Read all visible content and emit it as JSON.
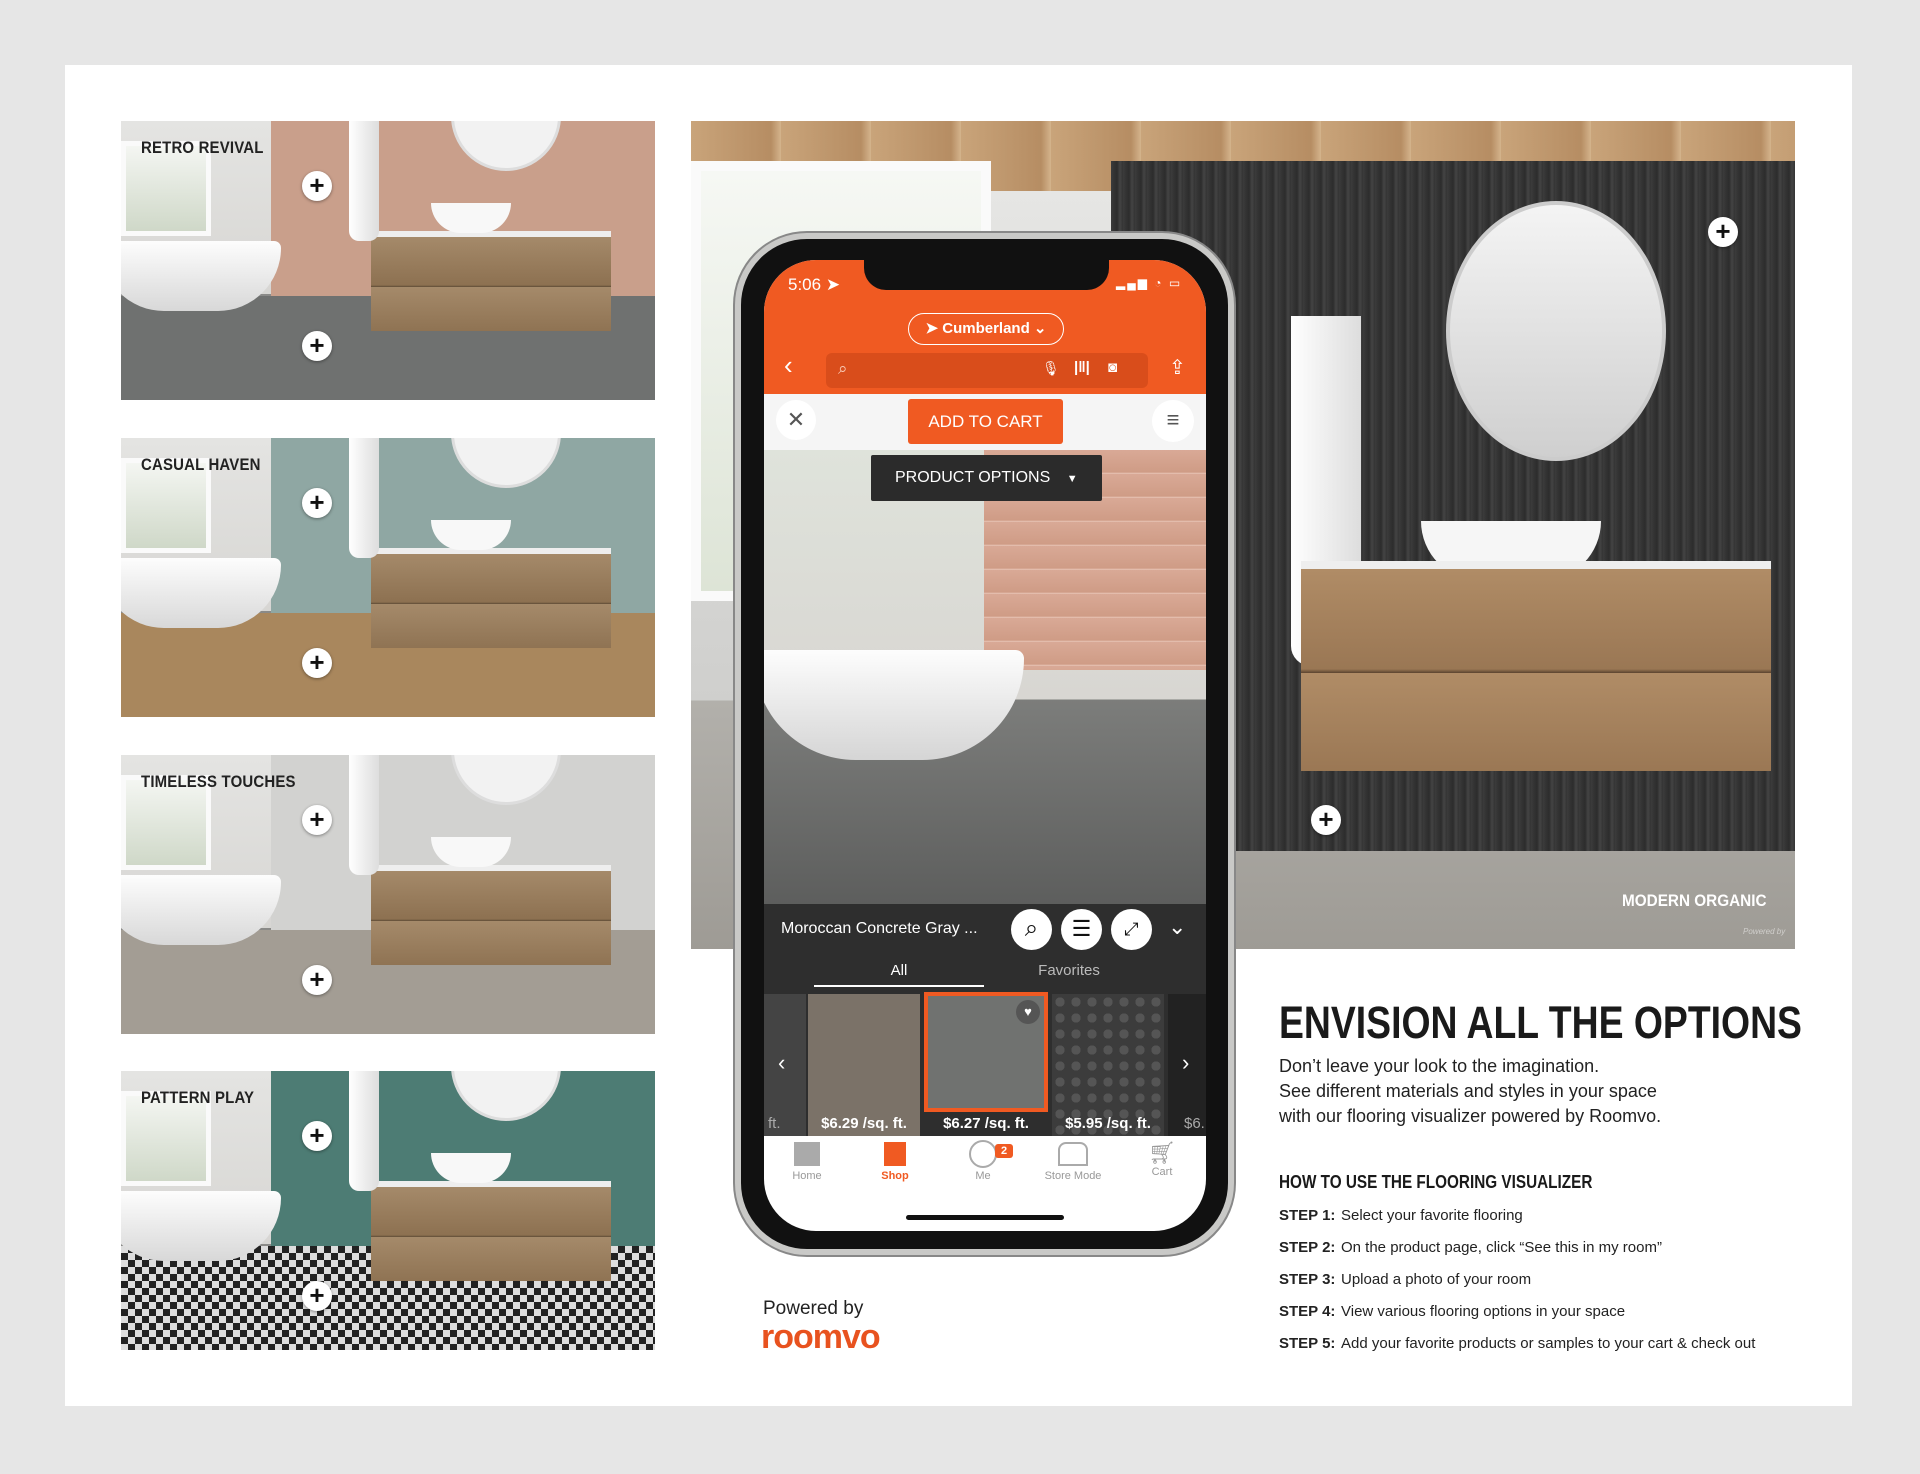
{
  "thumbnails": [
    {
      "label": "RETRO REVIVAL",
      "wall": "#c99f8b",
      "floor": "#6f7170"
    },
    {
      "label": "CASUAL HAVEN",
      "wall": "#8fa7a3",
      "floor": "#a9875d"
    },
    {
      "label": "TIMELESS TOUCHES",
      "wall": "#d2d2d0",
      "floor": "#a39d94"
    },
    {
      "label": "PATTERN PLAY",
      "wall": "#4d7c74",
      "floor": "#2a2a2a"
    }
  ],
  "hero": {
    "label": "MODERN ORGANIC",
    "watermark": "Powered by"
  },
  "phone": {
    "time": "5:06",
    "location": "Cumberland",
    "add_to_cart": "ADD TO CART",
    "product_options": "PRODUCT OPTIONS",
    "product_name": "Moroccan Concrete Gray ...",
    "tabs": [
      "All",
      "Favorites"
    ],
    "prices": [
      "ft.",
      "$6.29 /sq. ft.",
      "$6.27 /sq. ft.",
      "$5.95 /sq. ft.",
      "$6."
    ],
    "nav": [
      "Home",
      "Shop",
      "Me",
      "Store Mode",
      "Cart"
    ],
    "badge": "2",
    "accent": "#f05a22"
  },
  "powered": {
    "text": "Powered by",
    "brand": "roomvo",
    "brand_color": "#e8521f"
  },
  "copy": {
    "heading": "ENVISION ALL THE OPTIONS",
    "lines": [
      "Don’t leave your look to the imagination.",
      "See different materials and styles in your space",
      "with our flooring visualizer powered by Roomvo."
    ],
    "howto": "HOW TO USE THE FLOORING VISUALIZER",
    "steps": [
      {
        "label": "STEP 1:",
        "text": "Select your favorite flooring"
      },
      {
        "label": "STEP 2:",
        "text": "On the product page, click “See this in my room”"
      },
      {
        "label": "STEP 3:",
        "text": "Upload a photo of your room"
      },
      {
        "label": "STEP 4:",
        "text": "View various flooring options in your space"
      },
      {
        "label": "STEP 5:",
        "text": "Add your favorite products or samples to your cart & check out"
      }
    ]
  }
}
